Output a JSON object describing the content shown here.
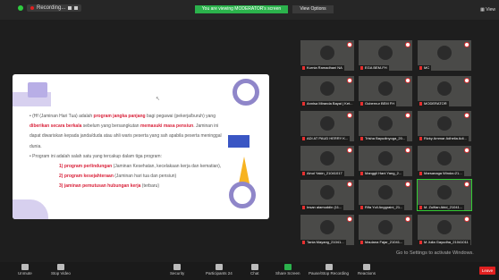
{
  "topbar": {
    "recording_label": "Recording...",
    "moderator_banner": "You are viewing MODERATOR's screen",
    "view_options": "View Options",
    "view_label": "View"
  },
  "slide": {
    "bullets": [
      {
        "parts": [
          {
            "t": "(Hf (Jaminan Hari Tua) adalah ",
            "red": false
          },
          {
            "t": "program jangka panjang",
            "red": true
          },
          {
            "t": " bagi pegawai (pekerja/buruh) yang ",
            "red": false
          },
          {
            "t": "diberikan secara berkala",
            "red": true
          },
          {
            "t": " sebelum yang bersangkutan ",
            "red": false
          },
          {
            "t": "memasuki masa pensiun",
            "red": true
          },
          {
            "t": ". Jaminan ini dapat diwariskan kepada janda/duda atau ahli waris peserta yang sah apabila peserta meninggal dunia.",
            "red": false
          }
        ]
      },
      {
        "parts": [
          {
            "t": "Program ini adalah salah satu yang tercakup dalam tiga program:",
            "red": false
          }
        ]
      }
    ],
    "sub_items": [
      {
        "num": "1) ",
        "red": "program perlindungan",
        "rest": " (Jaminan Kesehatan, kecelakaan kerja dan kematian),"
      },
      {
        "num": "2) ",
        "red": "program kesejahteraan",
        "rest": " (Jaminan hari tua dan pensiun)"
      },
      {
        "num": "3) ",
        "red": "jaminan pemutusan hubungan kerja",
        "rest": " (terbaru)"
      }
    ]
  },
  "participants": [
    {
      "name": "Kurnia Ramadhani NA"
    },
    {
      "name": "EGA BEM-FH"
    },
    {
      "name": "MC"
    },
    {
      "name": "Annisa Miranda Bayai | Ket..."
    },
    {
      "name": "Gubernur BEM FH"
    },
    {
      "name": "MODERATOR"
    },
    {
      "name": "ADI AT PAUD HERRY K..."
    },
    {
      "name": "Trisha Bayudinyoga_20..."
    },
    {
      "name": "Rizky Ammar Adhelia Adi..."
    },
    {
      "name": "Ainul Yakin_21041017"
    },
    {
      "name": "Manggli Hani Yang_2..."
    },
    {
      "name": "Marsanaga Winda=21..."
    },
    {
      "name": "Insan alamuddin (11..."
    },
    {
      "name": "Rifa Yuli Anggraini_21..."
    },
    {
      "name": "M. Zulfian Abid_21041..."
    },
    {
      "name": "Tania Mayang_21041..."
    },
    {
      "name": "Maulana Fajar_21041..."
    },
    {
      "name": "M Julia Gayudha_21041011"
    }
  ],
  "watermark": "Go to Settings to activate Windows.",
  "toolbar": {
    "unmute": "Unmute",
    "stop_video": "Stop Video",
    "security": "Security",
    "participants": "Participants",
    "participants_count": "24",
    "chat": "Chat",
    "share_screen": "Share Screen",
    "pause_recording": "Pause/Stop Recording",
    "reactions": "Reactions",
    "leave": "Leave"
  }
}
